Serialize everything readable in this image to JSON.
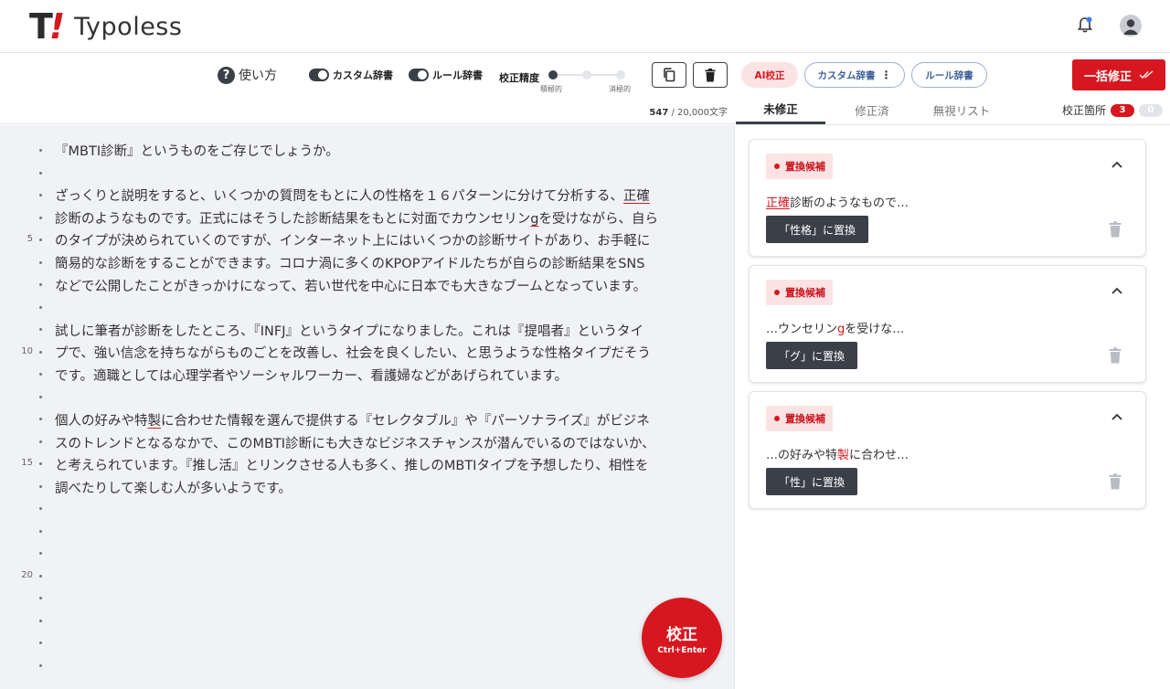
{
  "header": {
    "logo_mark": "T",
    "logo_bang": "!",
    "logo_text": "Typoless",
    "icons": [
      "bell-icon",
      "avatar-icon"
    ]
  },
  "toolbar": {
    "howto_label": "使い方",
    "custom_dict_toggle": "カスタム辞書",
    "rule_dict_toggle": "ルール辞書",
    "precision_label": "校正精度",
    "precision_left": "積極的",
    "precision_right": "消極的",
    "precision_level": 0,
    "char_count": "547",
    "char_limit": " / 20,000文字"
  },
  "editor": {
    "lines": [
      "『MBTI診断』というものをご存じでしょうか。",
      "",
      "ざっくりと説明をすると、いくつかの質問をもとに人の性格を１６パターンに分けて分析する、正確",
      "診断のようなものです。正式にはそうした診断結果をもとに対面でカウンセリンgを受けながら、自ら",
      "のタイプが決められていくのですが、インターネット上にはいくつかの診断サイトがあり、お手軽に",
      "簡易的な診断をすることができます。コロナ渦に多くのKPOPアイドルたちが自らの診断結果をSNS",
      "などで公開したことがきっかけになって、若い世代を中心に日本でも大きなブームとなっています。",
      "",
      "試しに筆者が診断をしたところ、『INFJ』というタイプになりました。これは『提唱者』というタイ",
      "プで、強い信念を持ちながらものごとを改善し、社会を良くしたい、と思うような性格タイプだそう",
      "です。適職としては心理学者やソーシャルワーカー、看護婦などがあげられています。",
      "",
      "個人の好みや特製に合わせた情報を選んで提供する『セレクタブル』や『パーソナライズ』がビジネ",
      "スのトレンドとなるなかで、このMBTI診断にも大きなビジネスチャンスが潜んでいるのではないか、",
      "と考えられています。『推し活』とリンクさせる人も多く、推しのMBTIタイプを予想したり、相性を",
      "調べたりして楽しむ人が多いようです。"
    ],
    "line_numbers": [
      "5",
      "10",
      "15",
      "20"
    ],
    "fab_label": "校正",
    "fab_shortcut": "Ctrl+Enter"
  },
  "panel": {
    "ai_label": "AI校正",
    "custom_dict_label": "カスタム辞書",
    "rule_dict_label": "ルール辞書",
    "bulk_label": "一括修正",
    "tabs": [
      "未修正",
      "修正済",
      "無視リスト"
    ],
    "kosei_label": "校正箇所",
    "count_unfixed": "3",
    "count_fixed": "0",
    "cards": [
      {
        "tag": "置換候補",
        "pre": "",
        "hit": "正確",
        "post": "診断のようなもので…",
        "apply": "「性格」に置換"
      },
      {
        "tag": "置換候補",
        "pre": "…ウンセリン",
        "hit": "g",
        "post": "を受けな…",
        "apply": "「グ」に置換"
      },
      {
        "tag": "置換候補",
        "pre": "…の好みや特",
        "hit": "製",
        "post": "に合わせ…",
        "apply": "「性」に置換"
      }
    ]
  },
  "colors": {
    "brand_red": "#d7171f",
    "dark": "#3a3f48",
    "editor_bg": "#f1f2f6"
  }
}
